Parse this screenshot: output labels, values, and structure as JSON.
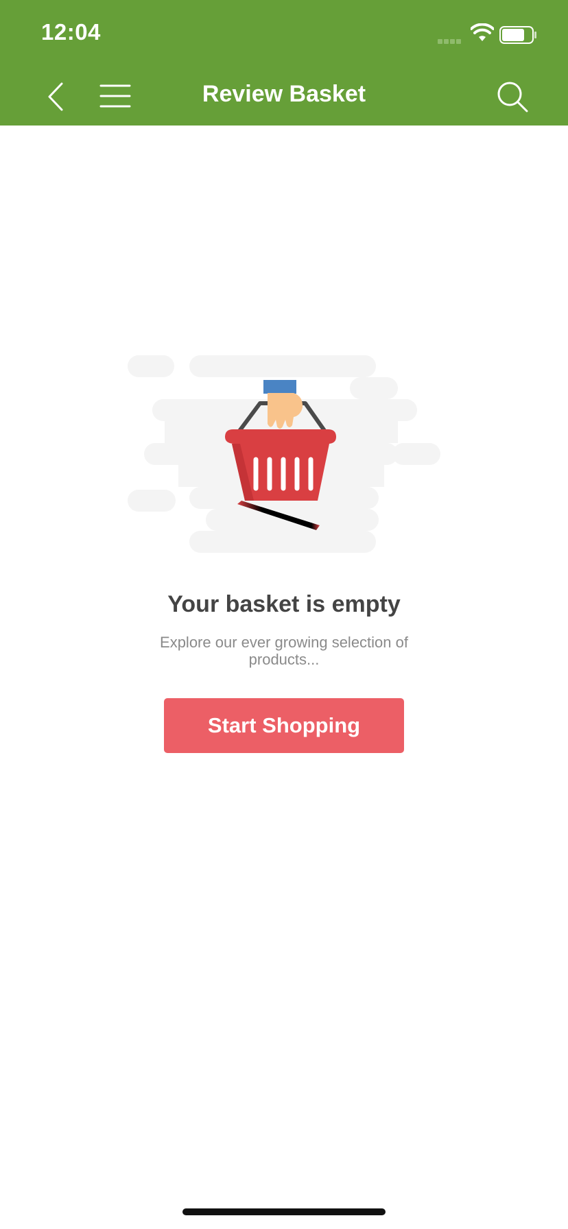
{
  "status_bar": {
    "time": "12:04",
    "icons": [
      "signal-icon",
      "wifi-icon",
      "battery-icon"
    ]
  },
  "header": {
    "title": "Review Basket",
    "background_color": "#669F38",
    "icons": [
      "back-chevron-icon",
      "menu-icon",
      "search-icon"
    ]
  },
  "empty_state": {
    "illustration": "hand-holding-basket-icon",
    "title": "Your basket is empty",
    "subtitle": "Explore our ever growing selection of products..."
  },
  "actions": {
    "start_shopping_label": "Start Shopping",
    "button_color": "#EC5F66"
  }
}
